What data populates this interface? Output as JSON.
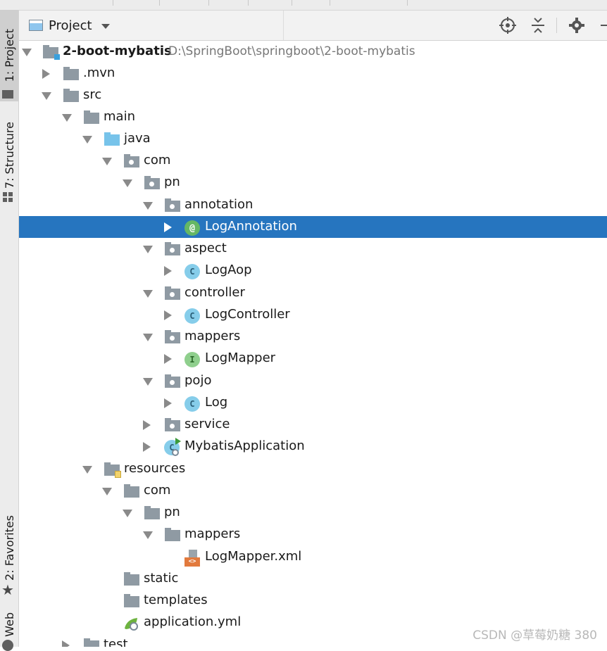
{
  "sidebar": {
    "tabs": [
      {
        "label": "1: Project",
        "active": true
      },
      {
        "label": "7: Structure",
        "active": false
      },
      {
        "label": "2: Favorites",
        "active": false
      },
      {
        "label": "Web",
        "active": false
      }
    ]
  },
  "header": {
    "title": "Project",
    "icons": [
      "locate-icon",
      "collapse-all-icon",
      "gear-icon",
      "hide-icon"
    ]
  },
  "tree": [
    {
      "label": "2-boot-mybatis",
      "path": "D:\\SpringBoot\\springboot\\2-boot-mybatis",
      "type": "module"
    },
    {
      "label": ".mvn",
      "type": "folder"
    },
    {
      "label": "src",
      "type": "folder"
    },
    {
      "label": "main",
      "type": "folder"
    },
    {
      "label": "java",
      "type": "source-folder"
    },
    {
      "label": "com",
      "type": "package"
    },
    {
      "label": "pn",
      "type": "package"
    },
    {
      "label": "annotation",
      "type": "package"
    },
    {
      "label": "LogAnnotation",
      "type": "annotation",
      "selected": true
    },
    {
      "label": "aspect",
      "type": "package"
    },
    {
      "label": "LogAop",
      "type": "class"
    },
    {
      "label": "controller",
      "type": "package"
    },
    {
      "label": "LogController",
      "type": "class"
    },
    {
      "label": "mappers",
      "type": "package"
    },
    {
      "label": "LogMapper",
      "type": "interface"
    },
    {
      "label": "pojo",
      "type": "package"
    },
    {
      "label": "Log",
      "type": "class"
    },
    {
      "label": "service",
      "type": "package"
    },
    {
      "label": "MybatisApplication",
      "type": "main-class"
    },
    {
      "label": "resources",
      "type": "resources"
    },
    {
      "label": "com",
      "type": "folder"
    },
    {
      "label": "pn",
      "type": "folder"
    },
    {
      "label": "mappers",
      "type": "folder"
    },
    {
      "label": "LogMapper.xml",
      "type": "xml"
    },
    {
      "label": "static",
      "type": "folder"
    },
    {
      "label": "templates",
      "type": "folder"
    },
    {
      "label": "application.yml",
      "type": "yml"
    },
    {
      "label": "test",
      "type": "folder"
    }
  ],
  "class_badges": {
    "class": "C",
    "interface": "I",
    "annotation": "@"
  },
  "colors": {
    "selection": "#2675bf",
    "folder": "#8f9aa3",
    "source_folder": "#77c3ea",
    "class": "#86cdea",
    "interface": "#8fcf8d"
  },
  "watermark": "CSDN @草莓奶糖 380"
}
